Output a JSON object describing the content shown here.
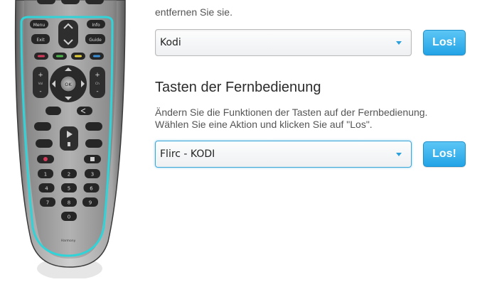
{
  "section_top": {
    "intro_text": "entfernen Sie sie.",
    "device_select": {
      "value": "Kodi"
    },
    "go_button": "Los!"
  },
  "section_buttons": {
    "heading": "Tasten der Fernbedienung",
    "description_line1": "Ändern Sie die Funktionen der Tasten auf der Fernbedienung.",
    "description_line2": "Wählen Sie eine Aktion und klicken Sie auf \"Los\".",
    "action_select": {
      "value": "Flirc - KODI"
    },
    "go_button": "Los!"
  },
  "remote": {
    "labels": {
      "menu": "Menu",
      "info": "Info",
      "exit": "Exit",
      "guide": "Guide",
      "ok": "OK",
      "vol": "Vol",
      "ch": "Ch",
      "brand": "Harmony"
    },
    "number_keys": [
      "1",
      "2",
      "3",
      "4",
      "5",
      "6",
      "7",
      "8",
      "9",
      "0"
    ],
    "colors": {
      "highlight": "#2fd3d8",
      "color_keys": [
        "#d63a5a",
        "#4cb84c",
        "#e5d33a",
        "#3a8fd6"
      ]
    }
  }
}
